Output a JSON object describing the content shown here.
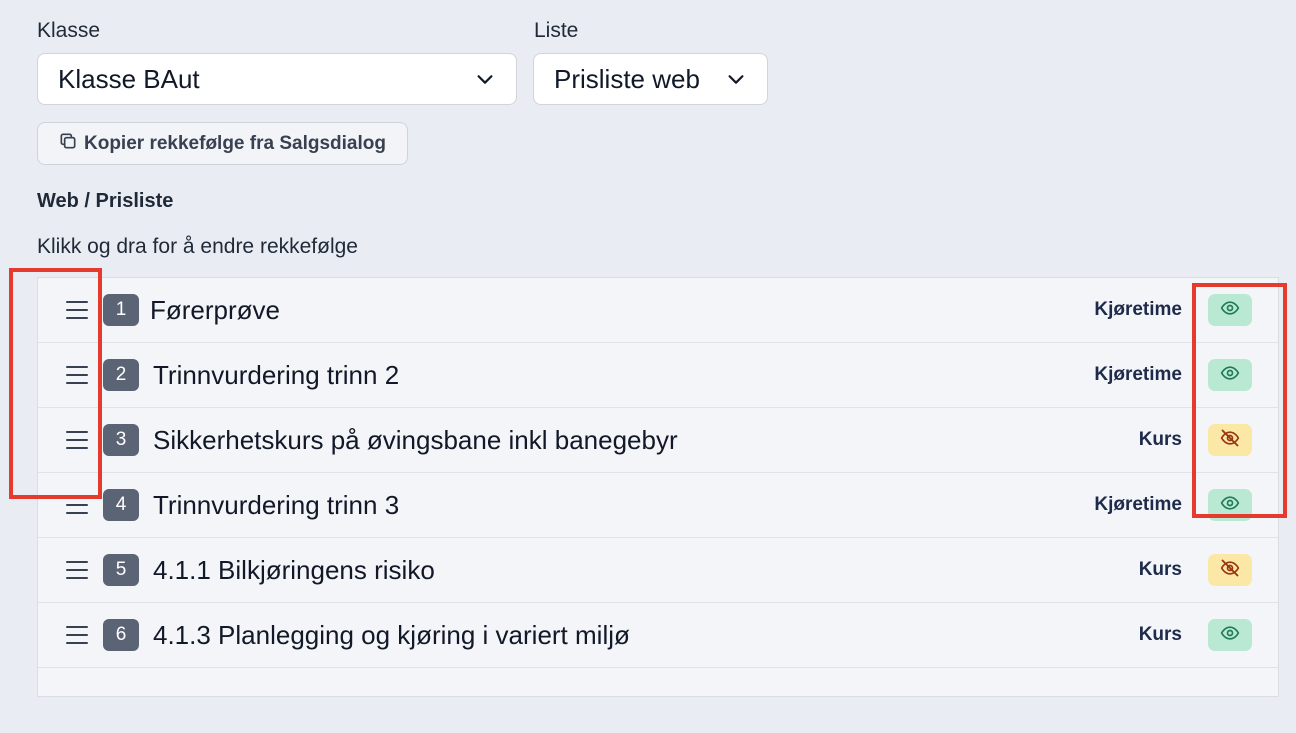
{
  "filters": {
    "klasse_label": "Klasse",
    "klasse_value": "Klasse BAut",
    "liste_label": "Liste",
    "liste_value": "Prisliste web"
  },
  "copy_button_label": "Kopier rekkefølge fra Salgsdialog",
  "section_title": "Web / Prisliste",
  "hint": "Klikk og dra for å endre rekkefølge",
  "items": [
    {
      "num": "1",
      "name": "Førerprøve",
      "category": "Kjøretime",
      "visible": true
    },
    {
      "num": "2",
      "name": "Trinnvurdering trinn 2",
      "category": "Kjøretime",
      "visible": true
    },
    {
      "num": "3",
      "name": "Sikkerhetskurs på øvingsbane inkl banegebyr",
      "category": "Kurs",
      "visible": false
    },
    {
      "num": "4",
      "name": "Trinnvurdering trinn 3",
      "category": "Kjøretime",
      "visible": true
    },
    {
      "num": "5",
      "name": "4.1.1 Bilkjøringens risiko",
      "category": "Kurs",
      "visible": false
    },
    {
      "num": "6",
      "name": "4.1.3 Planlegging og kjøring i variert miljø",
      "category": "Kurs",
      "visible": true
    }
  ],
  "colors": {
    "visible_bg": "#b9e8d3",
    "visible_icon": "#1f7a55",
    "hidden_bg": "#fbe7a6",
    "hidden_icon": "#9a3412",
    "highlight": "#e53a2e"
  },
  "icons": {
    "visible": "eye-icon",
    "hidden": "eye-off-icon",
    "drag": "drag-handle-icon",
    "copy": "copy-icon",
    "dropdown": "chevron-down-icon"
  }
}
